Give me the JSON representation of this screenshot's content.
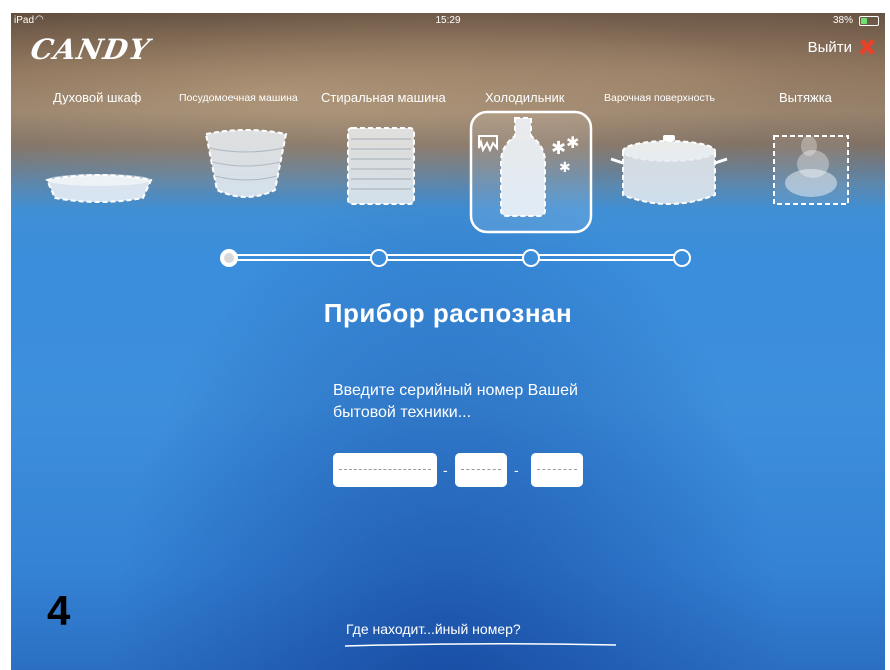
{
  "status_bar": {
    "device": "iPad",
    "time": "15:29",
    "battery": "38%",
    "battery_level": 0.38
  },
  "header": {
    "logo": "CANDY",
    "exit_label": "Выйти"
  },
  "categories": [
    {
      "label": "Духовой шкаф",
      "icon": "oven-dish-icon"
    },
    {
      "label": "Посудомоечная машина",
      "icon": "dish-stack-icon"
    },
    {
      "label": "Стиральная машина",
      "icon": "laundry-stack-icon"
    },
    {
      "label": "Холодильник",
      "icon": "fridge-bottle-icon",
      "selected": true
    },
    {
      "label": "Варочная поверхность",
      "icon": "cooking-pot-icon"
    },
    {
      "label": "Вытяжка",
      "icon": "steam-hood-icon"
    }
  ],
  "progress": {
    "steps": 4,
    "current": 1
  },
  "main": {
    "title": "Прибор распознан",
    "instruction_line1": "Введите серийный номер Вашей",
    "instruction_line2": "бытовой техники...",
    "serial_separator": "-",
    "help_link": "Где находит...йный номер?"
  },
  "annotation": {
    "step_number": "4"
  },
  "colors": {
    "accent": "#3a8edb",
    "exit_icon": "#e8412a"
  }
}
